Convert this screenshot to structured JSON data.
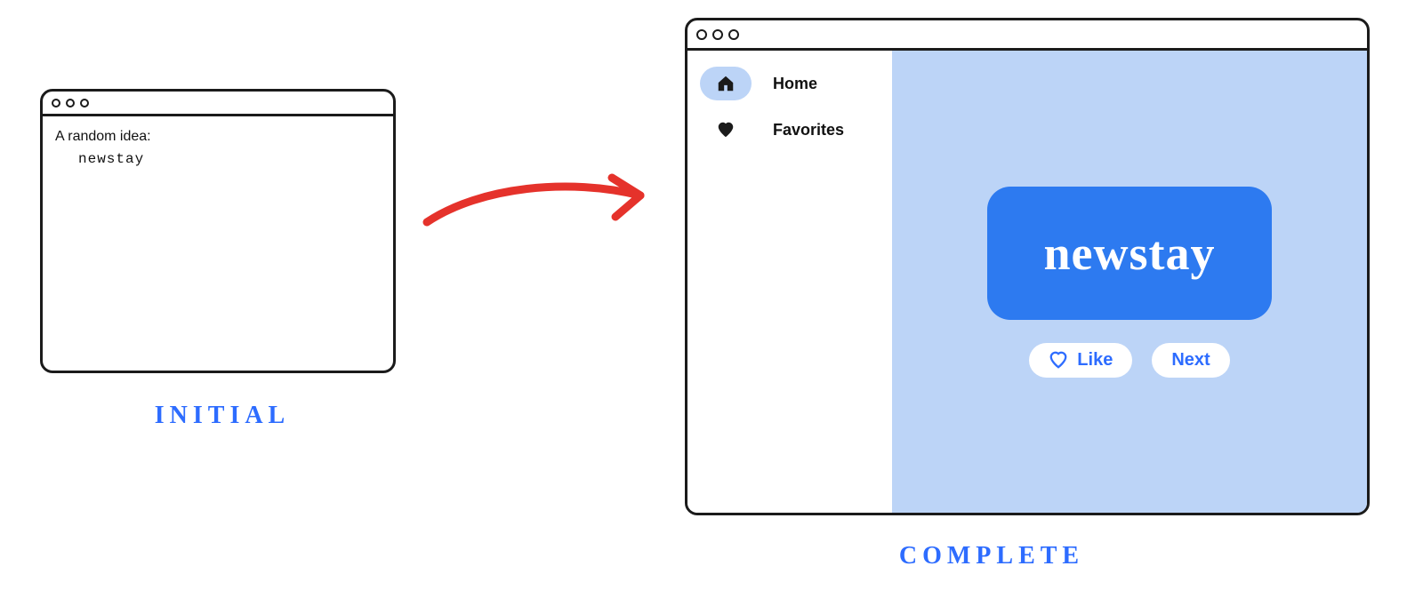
{
  "captions": {
    "initial": "INITIAL",
    "complete": "COMPLETE"
  },
  "initial_window": {
    "prompt": "A random idea:",
    "word": "newstay"
  },
  "complete_window": {
    "sidebar": {
      "items": [
        {
          "label": "Home",
          "icon": "home-icon",
          "active": true
        },
        {
          "label": "Favorites",
          "icon": "heart-icon",
          "active": false
        }
      ]
    },
    "main": {
      "card_word": "newstay",
      "like_label": "Like",
      "next_label": "Next"
    }
  },
  "colors": {
    "accent_blue": "#2d7af0",
    "panel_blue": "#bcd4f7",
    "text_blue": "#2d6cff",
    "arrow_red": "#e5322b",
    "ink": "#1b1b1b"
  }
}
